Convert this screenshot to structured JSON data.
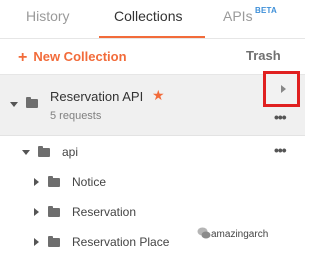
{
  "tabs": [
    {
      "label": "History"
    },
    {
      "label": "Collections"
    },
    {
      "label": "APIs",
      "badge": "BETA"
    }
  ],
  "active_tab": "Collections",
  "toolbar": {
    "new_collection_label": "New Collection",
    "trash_label": "Trash",
    "plus_icon": "plus-icon"
  },
  "collection": {
    "name": "Reservation API",
    "subtitle": "5 requests",
    "favorite": true
  },
  "tree": {
    "folder": "api",
    "children": [
      "Notice",
      "Reservation",
      "Reservation Place"
    ]
  },
  "watermark": "amazingarch",
  "colors": {
    "accent": "#f26b3a",
    "highlight": "#e02020",
    "beta": "#3e8fd8",
    "row_bg": "#f0f0f0"
  }
}
